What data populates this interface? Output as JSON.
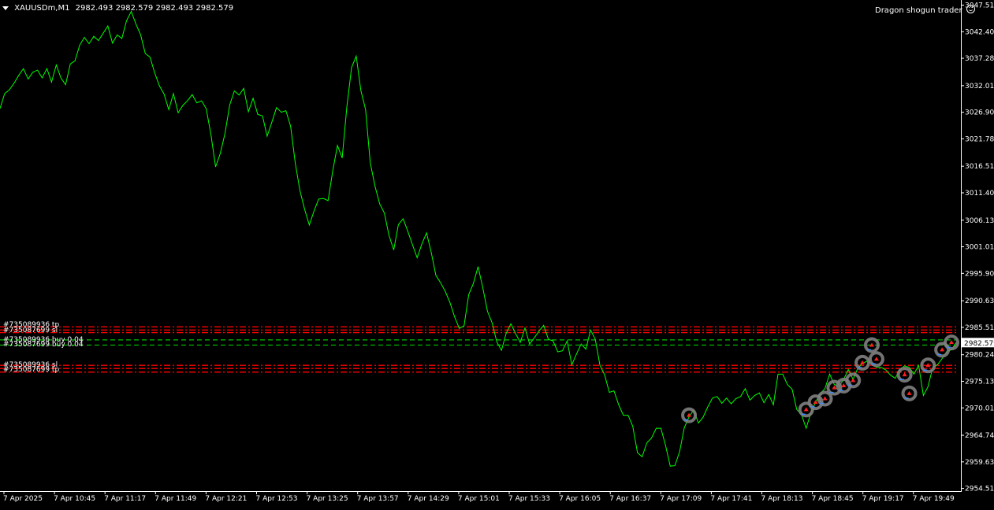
{
  "chart_header": {
    "menu_arrow": "triangle-down-icon",
    "symbol_timeframe": "XAUUSDm,M1",
    "ohlc": "2982.493 2982.579 2982.493 2982.579"
  },
  "expert_label": {
    "name": "Dragon shogun trader",
    "icon": "smiley-icon"
  },
  "price_axis": {
    "ticks": [
      "3047.515",
      "3042.400",
      "3037.285",
      "3032.015",
      "3026.900",
      "3021.785",
      "3016.515",
      "3011.400",
      "3006.130",
      "3001.015",
      "2995.900",
      "2990.630",
      "2985.515",
      "2980.245",
      "2975.130",
      "2970.015",
      "2964.745",
      "2959.630",
      "2954.515"
    ],
    "current_price": "2982.579"
  },
  "time_axis": {
    "ticks": [
      "7 Apr 2025",
      "7 Apr 10:45",
      "7 Apr 11:17",
      "7 Apr 11:49",
      "7 Apr 12:21",
      "7 Apr 12:53",
      "7 Apr 13:25",
      "7 Apr 13:57",
      "7 Apr 14:29",
      "7 Apr 15:01",
      "7 Apr 15:33",
      "7 Apr 16:05",
      "7 Apr 16:37",
      "7 Apr 17:09",
      "7 Apr 17:41",
      "7 Apr 18:13",
      "7 Apr 18:45",
      "7 Apr 19:17",
      "7 Apr 19:49"
    ]
  },
  "order_labels_top": [
    "#735089936 tp",
    "#735087699 sl",
    "#735089936 buy 0.04",
    "#735087699 buy 0.04"
  ],
  "order_labels_bottom": [
    "#735089936 sl",
    "#735087699 tp"
  ],
  "colors": {
    "background": "#000000",
    "price_line": "#00ff00",
    "sl_tp_lines": "#ff0000",
    "entry_lines": "#00c800",
    "axis_text": "#ffffff",
    "current_price_box": "#ffffff",
    "trade_marker_ring": "#808080",
    "trade_buy_arrow": "#3a8cff",
    "trade_sell_arrow": "#ff2020"
  },
  "chart_data": {
    "type": "line",
    "title": "XAUUSDm,M1",
    "series": [
      {
        "name": "",
        "values": [
          3027.6,
          3030.5,
          3031.2,
          3032.5,
          3034.0,
          3035.3,
          3033.3,
          3034.6,
          3035.0,
          3033.5,
          3035.3,
          3032.7,
          3036.0,
          3033.5,
          3032.2,
          3036.2,
          3036.8,
          3039.8,
          3041.3,
          3040.1,
          3041.5,
          3040.7,
          3042.1,
          3043.5,
          3040.2,
          3041.8,
          3041.1,
          3044.5,
          3046.3,
          3043.9,
          3041.8,
          3038.2,
          3037.5,
          3034.5,
          3032.0,
          3030.4,
          3027.4,
          3030.5,
          3026.8,
          3028.2,
          3029.1,
          3030.3,
          3028.7,
          3029.1,
          3027.6,
          3022.6,
          3016.4,
          3019.0,
          3022.8,
          3028.3,
          3031.0,
          3030.2,
          3031.5,
          3027.0,
          3029.6,
          3026.5,
          3026.2,
          3022.3,
          3025.0,
          3027.8,
          3026.9,
          3027.2,
          3024.2,
          3017.1,
          3011.8,
          3008.2,
          3005.2,
          3007.9,
          3010.2,
          3010.3,
          3009.9,
          3015.7,
          3020.5,
          3018.1,
          3027.9,
          3035.5,
          3037.7,
          3031.1,
          3027.4,
          3017.2,
          3012.7,
          3009.3,
          3007.5,
          3003.2,
          3000.4,
          3005.3,
          3006.4,
          3004.0,
          3001.4,
          2998.9,
          3001.5,
          3003.7,
          3000.0,
          2995.5,
          2994.1,
          2992.4,
          2990.3,
          2987.5,
          2985.3,
          2985.8,
          2991.8,
          2994.0,
          2997.2,
          2993.2,
          2988.6,
          2986.4,
          2982.7,
          2981.1,
          2984.4,
          2986.2,
          2984.3,
          2982.6,
          2985.4,
          2982.3,
          2983.5,
          2984.8,
          2985.9,
          2983.2,
          2982.9,
          2980.8,
          2981.0,
          2982.9,
          2978.3,
          2980.4,
          2982.3,
          2981.3,
          2985.0,
          2983.2,
          2978.2,
          2976.4,
          2973.0,
          2973.3,
          2970.6,
          2968.6,
          2968.6,
          2966.5,
          2961.4,
          2960.6,
          2963.3,
          2964.2,
          2966.1,
          2966.1,
          2962.8,
          2958.8,
          2958.9,
          2961.6,
          2966.2,
          2968.3,
          2969.6,
          2967.1,
          2968.2,
          2970.2,
          2971.9,
          2972.2,
          2970.9,
          2971.9,
          2970.8,
          2971.8,
          2972.2,
          2973.7,
          2971.5,
          2972.4,
          2972.9,
          2971.0,
          2972.6,
          2970.6,
          2976.5,
          2976.5,
          2974.5,
          2973.6,
          2969.7,
          2968.7,
          2966.1,
          2969.1,
          2971.1,
          2972.8,
          2973.7,
          2976.5,
          2974.5,
          2974.1,
          2975.5,
          2977.4,
          2975.5,
          2977.6,
          2978.6,
          2979.0,
          2978.6,
          2977.8,
          2977.8,
          2977.3,
          2976.3,
          2975.7,
          2977.4,
          2978.1,
          2977.8,
          2976.5,
          2978.2,
          2972.4,
          2974.1,
          2977.8,
          2978.3,
          2979.5,
          2980.9,
          2981.2,
          2982.6
        ]
      }
    ],
    "ylim": [
      2954.0,
      3048.5
    ],
    "y_axis_side": "right",
    "horizontal_levels": {
      "take_profit_and_stop_loss_upper": [
        2985.6,
        2985.0,
        2984.5
      ],
      "entry": [
        2983.1,
        2982.1
      ],
      "take_profit_and_stop_loss_lower": [
        2978.2,
        2977.6,
        2976.9
      ]
    },
    "trade_markers": [
      {
        "x_index": 147,
        "price": 2968.6
      },
      {
        "x_index": 172,
        "price": 2969.7
      },
      {
        "x_index": 174,
        "price": 2971.1
      },
      {
        "x_index": 176,
        "price": 2971.8
      },
      {
        "x_index": 178,
        "price": 2973.9
      },
      {
        "x_index": 180,
        "price": 2974.3
      },
      {
        "x_index": 182,
        "price": 2975.3
      },
      {
        "x_index": 184,
        "price": 2978.7
      },
      {
        "x_index": 186,
        "price": 2982.1
      },
      {
        "x_index": 187,
        "price": 2979.4
      },
      {
        "x_index": 193,
        "price": 2976.4
      },
      {
        "x_index": 194,
        "price": 2972.8
      },
      {
        "x_index": 198,
        "price": 2978.2
      },
      {
        "x_index": 201,
        "price": 2981.2
      },
      {
        "x_index": 203,
        "price": 2982.6
      }
    ],
    "grid": false,
    "legend": "none"
  }
}
